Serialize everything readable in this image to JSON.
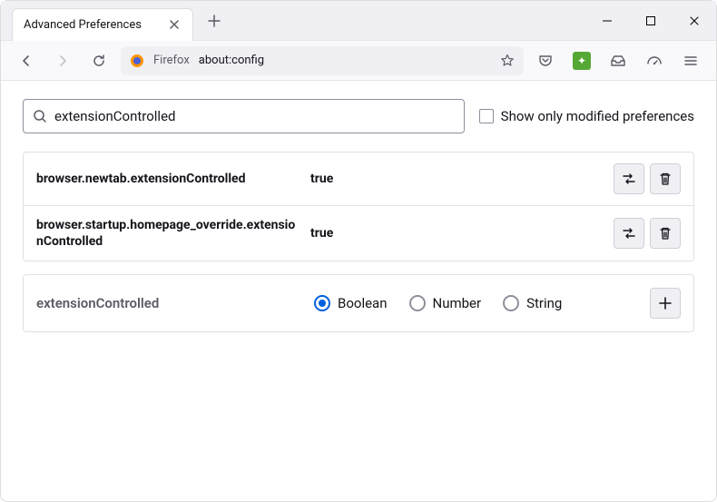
{
  "titlebar": {
    "tab_title": "Advanced Preferences"
  },
  "navbar": {
    "context": "Firefox",
    "url": "about:config"
  },
  "search": {
    "value": "extensionControlled",
    "checkbox_label": "Show only modified preferences"
  },
  "prefs": [
    {
      "name": "browser.newtab.extensionControlled",
      "value": "true"
    },
    {
      "name": "browser.startup.homepage_override.extensionControlled",
      "value": "true"
    }
  ],
  "new_pref": {
    "name": "extensionControlled",
    "types": [
      "Boolean",
      "Number",
      "String"
    ],
    "selected": "Boolean"
  }
}
